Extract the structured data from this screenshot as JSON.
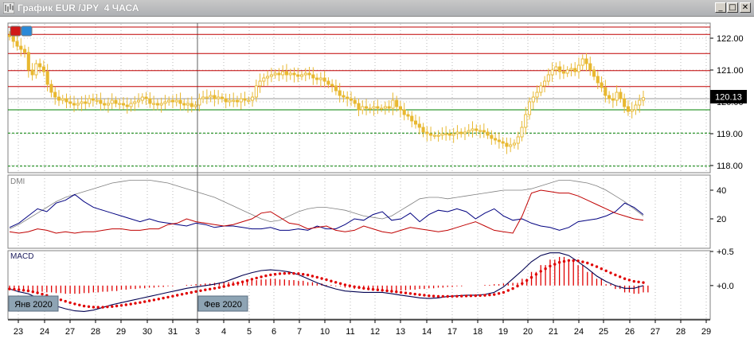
{
  "window": {
    "title": "График EUR /JPY  4 ЧАСА",
    "minimize_icon": "minimize-icon",
    "restore_icon": "restore-icon",
    "close_icon": "close-icon"
  },
  "colors": {
    "up_candle": "#e8b830",
    "resistance_line": "#c00000",
    "support_line": "#008000",
    "dmi_adx": "#808080",
    "dmi_plus": "#000080",
    "dmi_minus": "#c00000",
    "macd_line": "#000050",
    "macd_signal": "#e00000"
  },
  "chart_data": [
    {
      "type": "candlestick",
      "name": "EUR/JPY 4H",
      "ylim": [
        117.8,
        122.45
      ],
      "y_ticks": [
        "122.00",
        "121.00",
        "120.00",
        "119.00",
        "118.00"
      ],
      "current_price": "120.13",
      "resistance_levels": [
        122.35,
        122.12,
        121.52,
        120.98,
        120.48
      ],
      "mid_levels": [
        120.1
      ],
      "support_levels": [
        119.75,
        119.02,
        117.98
      ],
      "closes": [
        122.05,
        121.9,
        121.75,
        121.65,
        121.55,
        121.0,
        120.85,
        121.2,
        121.1,
        120.95,
        120.55,
        120.3,
        120.15,
        120.05,
        120.1,
        120.0,
        119.95,
        119.9,
        119.95,
        120.0,
        119.95,
        120.1,
        120.05,
        120.05,
        119.95,
        119.9,
        119.95,
        120.05,
        119.95,
        119.95,
        119.9,
        119.85,
        119.95,
        120.0,
        120.05,
        120.15,
        120.1,
        119.95,
        119.95,
        119.9,
        119.95,
        120.0,
        120.05,
        120.0,
        120.05,
        119.95,
        119.9,
        119.95,
        119.85,
        119.9,
        120.1,
        120.15,
        120.15,
        120.2,
        120.1,
        120.15,
        120.1,
        120.0,
        120.05,
        120.05,
        120.0,
        120.1,
        120.05,
        120.05,
        120.15,
        120.5,
        120.65,
        120.75,
        120.8,
        120.85,
        120.9,
        120.85,
        120.95,
        120.85,
        120.9,
        120.85,
        120.8,
        120.85,
        120.9,
        120.85,
        120.75,
        120.7,
        120.75,
        120.65,
        120.55,
        120.5,
        120.35,
        120.2,
        120.15,
        120.1,
        120.05,
        119.95,
        119.75,
        119.85,
        119.8,
        119.8,
        119.85,
        119.8,
        119.8,
        119.85,
        119.8,
        120.05,
        119.85,
        119.75,
        119.6,
        119.55,
        119.4,
        119.3,
        119.2,
        119.05,
        119.0,
        118.95,
        118.95,
        118.95,
        119.0,
        119.0,
        118.95,
        119.0,
        119.05,
        119.0,
        119.05,
        119.1,
        119.15,
        119.1,
        119.1,
        119.05,
        118.95,
        118.85,
        118.8,
        118.75,
        118.7,
        118.6,
        118.65,
        118.7,
        118.9,
        119.2,
        119.6,
        120.0,
        120.15,
        120.3,
        120.5,
        120.65,
        120.85,
        121.0,
        121.1,
        120.95,
        120.9,
        121.0,
        121.05,
        120.95,
        121.15,
        121.35,
        121.2,
        121.0,
        120.8,
        120.6,
        120.45,
        120.2,
        120.1,
        120.05,
        120.3,
        120.1,
        119.85,
        119.7,
        119.75,
        119.9,
        120.05,
        120.13
      ]
    },
    {
      "type": "line",
      "title": "DMI",
      "ylim": [
        0,
        50
      ],
      "y_ticks": [
        "40",
        "20"
      ],
      "series": [
        {
          "values": [
            13,
            16,
            20,
            24,
            28,
            32,
            35,
            37,
            39,
            41,
            43,
            45,
            46,
            47,
            47,
            47,
            46,
            45,
            43,
            41,
            39,
            37,
            35,
            32,
            29,
            26,
            23,
            20,
            18,
            19,
            22,
            25,
            27,
            28,
            28,
            27,
            26,
            24,
            22,
            21,
            20,
            22,
            26,
            30,
            34,
            35,
            35,
            34,
            35,
            36,
            37,
            38,
            39,
            40,
            40,
            40,
            41,
            43,
            45,
            47,
            47,
            46,
            45,
            43,
            40,
            36,
            32,
            27,
            22
          ]
        },
        {
          "values": [
            14,
            17,
            22,
            27,
            25,
            31,
            33,
            37,
            32,
            28,
            26,
            24,
            22,
            20,
            18,
            20,
            18,
            17,
            16,
            15,
            17,
            16,
            14,
            15,
            15,
            14,
            13,
            13,
            14,
            12,
            12,
            13,
            12,
            15,
            13,
            13,
            16,
            20,
            19,
            23,
            25,
            19,
            20,
            24,
            18,
            23,
            26,
            25,
            27,
            25,
            20,
            24,
            27,
            22,
            19,
            20,
            17,
            15,
            14,
            12,
            14,
            18,
            19,
            20,
            22,
            25,
            31,
            28,
            23
          ]
        },
        {
          "values": [
            11,
            10,
            11,
            13,
            12,
            10,
            11,
            10,
            11,
            11,
            12,
            13,
            13,
            12,
            12,
            13,
            13,
            16,
            17,
            20,
            18,
            17,
            16,
            15,
            16,
            18,
            20,
            24,
            25,
            21,
            17,
            16,
            13,
            14,
            15,
            12,
            11,
            12,
            15,
            13,
            11,
            10,
            12,
            14,
            13,
            12,
            11,
            12,
            14,
            16,
            18,
            15,
            12,
            11,
            10,
            22,
            38,
            40,
            39,
            38,
            38,
            36,
            33,
            30,
            27,
            24,
            22,
            20,
            19
          ]
        }
      ]
    },
    {
      "type": "bar+line",
      "title": "MACD",
      "ylim": [
        -0.48,
        0.5
      ],
      "y_ticks": [
        "+0.5",
        "+0.0"
      ],
      "histogram": [
        -0.05,
        -0.06,
        -0.08,
        -0.09,
        -0.1,
        -0.11,
        -0.12,
        -0.12,
        -0.11,
        -0.1,
        -0.09,
        -0.08,
        -0.06,
        -0.05,
        -0.04,
        -0.03,
        -0.02,
        -0.01,
        0.0,
        0.01,
        0.02,
        0.03,
        0.04,
        0.05,
        0.06,
        0.07,
        0.08,
        0.09,
        0.1,
        0.09,
        0.08,
        0.07,
        0.05,
        0.03,
        0.01,
        -0.01,
        -0.03,
        -0.05,
        -0.06,
        -0.07,
        -0.08,
        -0.08,
        -0.07,
        -0.06,
        -0.05,
        -0.04,
        -0.03,
        -0.02,
        -0.01,
        0.0,
        0.0,
        0.01,
        0.02,
        0.03,
        0.04,
        0.1,
        0.2,
        0.3,
        0.38,
        0.42,
        0.38,
        0.3,
        0.2,
        0.1,
        0.02,
        -0.05,
        -0.1,
        -0.12,
        -0.1
      ],
      "macd": [
        -0.05,
        -0.09,
        -0.12,
        -0.18,
        -0.24,
        -0.3,
        -0.34,
        -0.37,
        -0.38,
        -0.36,
        -0.32,
        -0.28,
        -0.25,
        -0.22,
        -0.19,
        -0.16,
        -0.13,
        -0.1,
        -0.07,
        -0.04,
        -0.02,
        0.0,
        0.02,
        0.05,
        0.1,
        0.15,
        0.19,
        0.22,
        0.23,
        0.22,
        0.2,
        0.16,
        0.1,
        0.04,
        -0.01,
        -0.05,
        -0.08,
        -0.09,
        -0.1,
        -0.1,
        -0.1,
        -0.12,
        -0.14,
        -0.16,
        -0.18,
        -0.19,
        -0.18,
        -0.16,
        -0.15,
        -0.14,
        -0.14,
        -0.13,
        -0.1,
        -0.02,
        0.1,
        0.22,
        0.35,
        0.44,
        0.48,
        0.48,
        0.44,
        0.35,
        0.25,
        0.14,
        0.06,
        0.0,
        -0.04,
        -0.04,
        0.0
      ]
    }
  ],
  "time_axis": {
    "labels": [
      "23",
      "24",
      "27",
      "28",
      "29",
      "30",
      "31",
      "3",
      "4",
      "5",
      "6",
      "7",
      "10",
      "11",
      "12",
      "13",
      "14",
      "17",
      "18",
      "19",
      "20",
      "21",
      "24",
      "25",
      "26",
      "27",
      "28",
      "29"
    ],
    "month_flags": [
      "Янв 2020",
      "Фев 2020"
    ]
  }
}
